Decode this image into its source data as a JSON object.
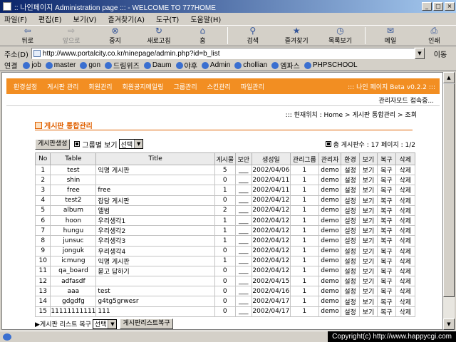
{
  "window": {
    "title": ":: 나인페이지 Administration page ::: - WELCOME TO 777HOME",
    "min": "_",
    "max": "□",
    "close": "×"
  },
  "menu": [
    "파일(F)",
    "편집(E)",
    "보기(V)",
    "즐겨찾기(A)",
    "도구(T)",
    "도움말(H)"
  ],
  "toolbar": [
    {
      "label": "뒤로",
      "icon": "back-arrow-icon",
      "glyph": "⇦",
      "enabled": true
    },
    {
      "label": "앞으로",
      "icon": "forward-arrow-icon",
      "glyph": "⇨",
      "enabled": false
    },
    {
      "label": "중지",
      "icon": "stop-icon",
      "glyph": "⊗",
      "enabled": true
    },
    {
      "label": "새로고침",
      "icon": "refresh-icon",
      "glyph": "↻",
      "enabled": true
    },
    {
      "label": "홈",
      "icon": "home-icon",
      "glyph": "⌂",
      "enabled": true
    },
    {
      "label": "검색",
      "icon": "search-icon",
      "glyph": "⚲",
      "enabled": true
    },
    {
      "label": "즐겨찾기",
      "icon": "favorites-icon",
      "glyph": "★",
      "enabled": true
    },
    {
      "label": "목록보기",
      "icon": "history-icon",
      "glyph": "◷",
      "enabled": true
    },
    {
      "label": "메일",
      "icon": "mail-icon",
      "glyph": "✉",
      "enabled": true
    },
    {
      "label": "인쇄",
      "icon": "print-icon",
      "glyph": "⎙",
      "enabled": true
    }
  ],
  "address": {
    "label": "주소(D)",
    "url": "http://www.portalcity.co.kr/ninepage/admin.php?id=b_list",
    "go": "이동"
  },
  "links": {
    "label": "연결",
    "items": [
      "job",
      "master",
      "gon",
      "드림위즈",
      "Daum",
      "야후",
      "Admin",
      "chollian",
      "엠파스",
      "PHPSCHOOL"
    ]
  },
  "nav": {
    "items": [
      "환경설정",
      "게시판 관리",
      "회원관리",
      "회원공지메일링",
      "그룹관리",
      "스킨관리",
      "파일관리"
    ],
    "beta": "::: 나인 페이지 Beta v0.2.2 :::",
    "mode": "관리자모드 접속중..."
  },
  "location": "::: 현재위치 : Home > 게시판 통합관리 > 조회",
  "section_title": "게시판 통합관리",
  "controls": {
    "create_btn": "게시판생성",
    "group_view": "그룹별 보기",
    "select_value": "선택",
    "total": "총 게시판수 : 17  페이지 : 1/2"
  },
  "table": {
    "headers": [
      "No",
      "Table",
      "Title",
      "게시물",
      "보안",
      "생성일",
      "관리그룹",
      "관리자",
      "환경",
      "보기",
      "복구",
      "삭제"
    ],
    "rows": [
      [
        "1",
        "test",
        "익명 게시판",
        "5",
        "___",
        "2002/04/06",
        "1",
        "demo",
        "설정",
        "보기",
        "복구",
        "삭제"
      ],
      [
        "2",
        "shin",
        "",
        "0",
        "___",
        "2002/04/11",
        "1",
        "demo",
        "설정",
        "보기",
        "복구",
        "삭제"
      ],
      [
        "3",
        "free",
        "free",
        "1",
        "___",
        "2002/04/11",
        "1",
        "demo",
        "설정",
        "보기",
        "복구",
        "삭제"
      ],
      [
        "4",
        "test2",
        "잡담 게시판",
        "0",
        "___",
        "2002/04/12",
        "1",
        "demo",
        "설정",
        "보기",
        "복구",
        "삭제"
      ],
      [
        "5",
        "album",
        "앨범",
        "2",
        "___",
        "2002/04/12",
        "1",
        "demo",
        "설정",
        "보기",
        "복구",
        "삭제"
      ],
      [
        "6",
        "hoon",
        "우리생각1",
        "1",
        "___",
        "2002/04/12",
        "1",
        "demo",
        "설정",
        "보기",
        "복구",
        "삭제"
      ],
      [
        "7",
        "hungu",
        "우리생각2",
        "1",
        "___",
        "2002/04/12",
        "1",
        "demo",
        "설정",
        "보기",
        "복구",
        "삭제"
      ],
      [
        "8",
        "junsuc",
        "우리생각3",
        "1",
        "___",
        "2002/04/12",
        "1",
        "demo",
        "설정",
        "보기",
        "복구",
        "삭제"
      ],
      [
        "9",
        "jonguk",
        "우리생각4",
        "0",
        "___",
        "2002/04/12",
        "1",
        "demo",
        "설정",
        "보기",
        "복구",
        "삭제"
      ],
      [
        "10",
        "icmung",
        "익명 게시판",
        "1",
        "___",
        "2002/04/12",
        "1",
        "demo",
        "설정",
        "보기",
        "복구",
        "삭제"
      ],
      [
        "11",
        "qa_board",
        "묻고 답하기",
        "0",
        "___",
        "2002/04/12",
        "1",
        "demo",
        "설정",
        "보기",
        "복구",
        "삭제"
      ],
      [
        "12",
        "adfasdf",
        "",
        "0",
        "___",
        "2002/04/15",
        "1",
        "demo",
        "설정",
        "보기",
        "복구",
        "삭제"
      ],
      [
        "13",
        "aaa",
        "test",
        "0",
        "___",
        "2002/04/16",
        "1",
        "demo",
        "설정",
        "보기",
        "복구",
        "삭제"
      ],
      [
        "14",
        "gdgdfg",
        "g4tg5grwesr",
        "0",
        "___",
        "2002/04/17",
        "1",
        "demo",
        "설정",
        "보기",
        "복구",
        "삭제"
      ],
      [
        "15",
        "11111111111",
        "111",
        "0",
        "___",
        "2002/04/17",
        "1",
        "demo",
        "설정",
        "보기",
        "복구",
        "삭제"
      ]
    ]
  },
  "footer": {
    "restore_label": "▶게시판 리스트 복구",
    "select_value": "선택",
    "restore_btn": "게시판리스트복구"
  },
  "status": {
    "copyright": "Copyright(c) http://www.happycgi.com"
  }
}
